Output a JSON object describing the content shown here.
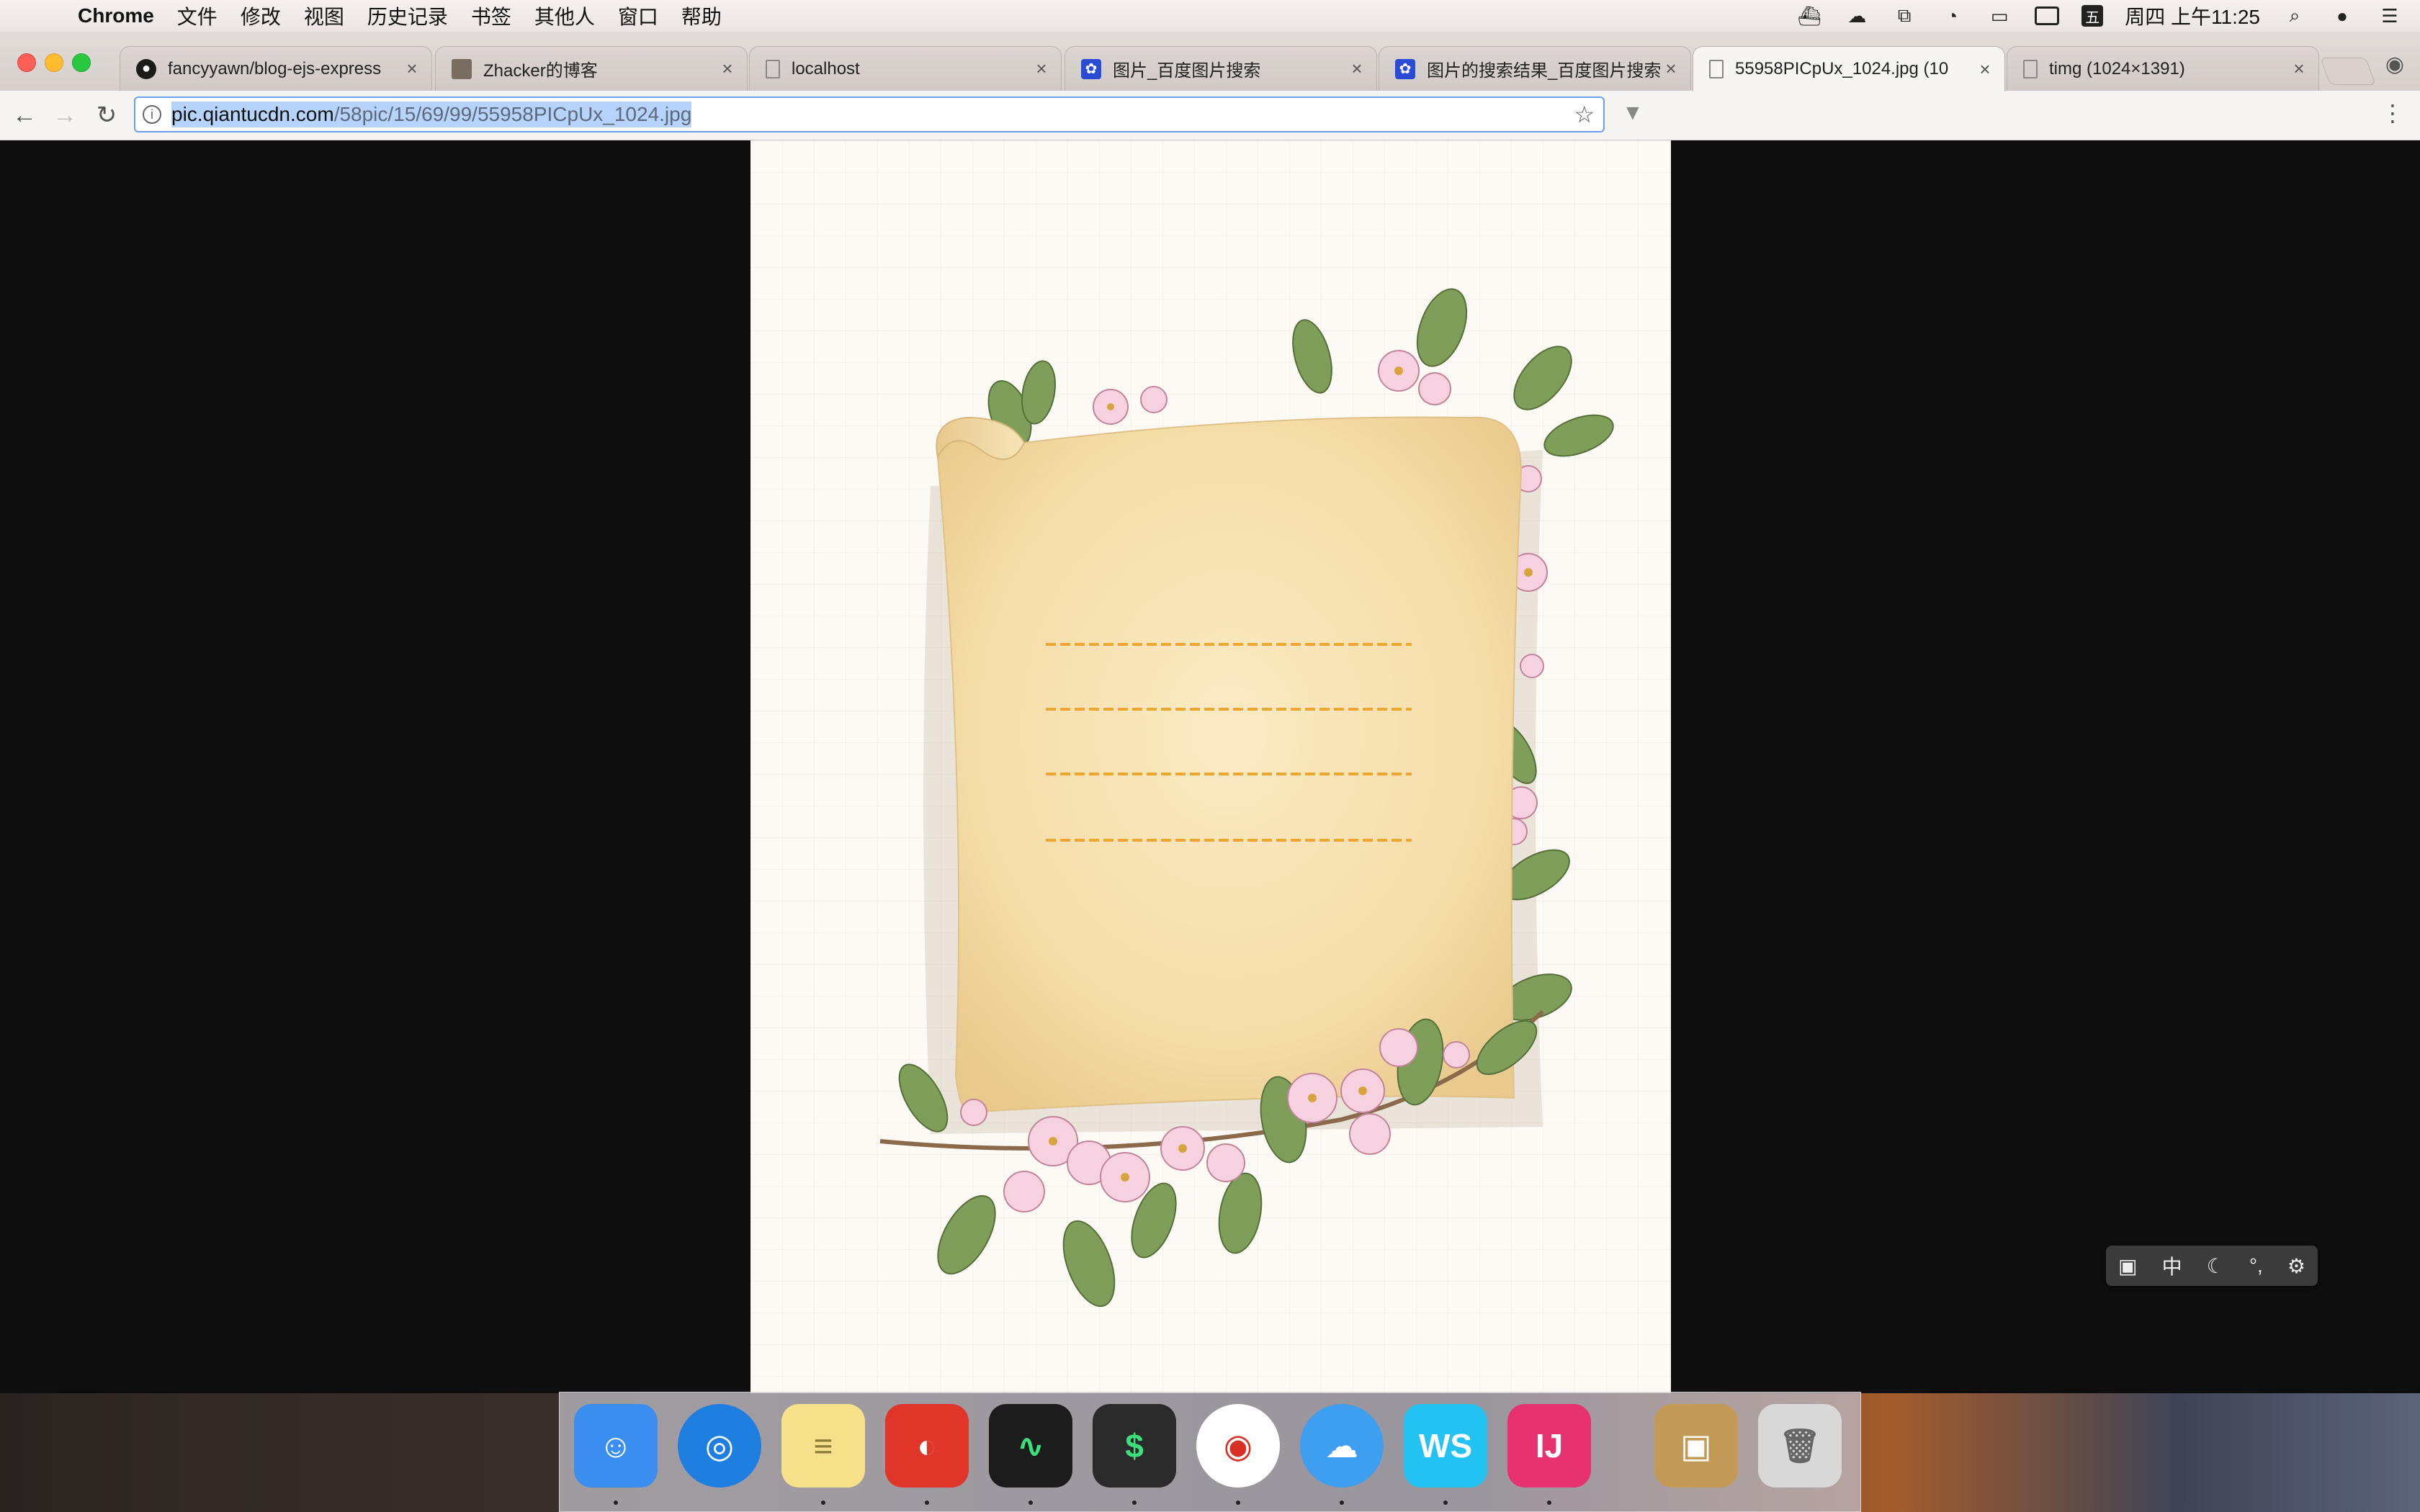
{
  "menubar": {
    "app_name": "Chrome",
    "items": [
      "文件",
      "修改",
      "视图",
      "历史记录",
      "书签",
      "其他人",
      "窗口",
      "帮助"
    ],
    "clock": "周四 上午11:25",
    "ime_label": "五"
  },
  "tabs": [
    {
      "title": "fancyyawn/blog-ejs-express",
      "icon": "github-icon",
      "active": false
    },
    {
      "title": "Zhacker的博客",
      "icon": "image-favicon-icon",
      "active": false
    },
    {
      "title": "localhost",
      "icon": "document-icon",
      "active": false
    },
    {
      "title": "图片_百度图片搜索",
      "icon": "baidu-icon",
      "active": false
    },
    {
      "title": "图片的搜索结果_百度图片搜索",
      "icon": "baidu-icon",
      "active": false
    },
    {
      "title": "55958PICpUx_1024.jpg (10",
      "icon": "document-icon",
      "active": true
    },
    {
      "title": "timg (1024×1391)",
      "icon": "document-icon",
      "active": false
    }
  ],
  "toolbar": {
    "url_host": "pic.qiantucdn.com",
    "url_path": "/58pic/15/69/99/55958PICpUx_1024.jpg"
  },
  "float_toolbar": {
    "zh_label": "中"
  },
  "dock": {
    "apps": [
      {
        "name": "finder",
        "color": "#3a8ef0",
        "glyph": "☺"
      },
      {
        "name": "safari",
        "color": "#1f7fe0",
        "glyph": "◎"
      },
      {
        "name": "notes",
        "color": "#f7e08a",
        "glyph": "≡"
      },
      {
        "name": "netease-music",
        "color": "#e0362a",
        "glyph": "◐"
      },
      {
        "name": "activity-monitor",
        "color": "#1c1c1c",
        "glyph": "∿"
      },
      {
        "name": "terminal",
        "color": "#2a2a2a",
        "glyph": "$"
      },
      {
        "name": "chrome",
        "color": "#ffffff",
        "glyph": "◉"
      },
      {
        "name": "icloud-drive",
        "color": "#3e9ef0",
        "glyph": "☁"
      },
      {
        "name": "webstorm",
        "color": "#22c3f3",
        "glyph": "WS"
      },
      {
        "name": "intellij-idea",
        "color": "#e6326e",
        "glyph": "IJ"
      },
      {
        "name": "archive-utility",
        "color": "#c39a55",
        "glyph": "▣"
      },
      {
        "name": "trash",
        "color": "#d8d8d8",
        "glyph": "🗑"
      }
    ]
  }
}
